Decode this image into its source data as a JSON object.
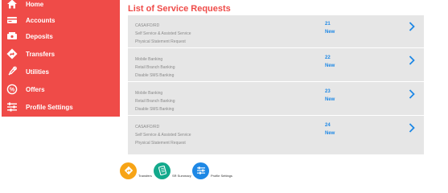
{
  "sidebar": {
    "items": [
      {
        "label": "Home",
        "icon": "home-icon"
      },
      {
        "label": "Accounts",
        "icon": "accounts-icon"
      },
      {
        "label": "Deposits",
        "icon": "deposits-icon"
      },
      {
        "label": "Transfers",
        "icon": "transfers-icon"
      },
      {
        "label": "Utilities",
        "icon": "utilities-icon"
      },
      {
        "label": "Offers",
        "icon": "offers-icon"
      },
      {
        "label": "Profile Settings",
        "icon": "profile-settings-icon"
      }
    ]
  },
  "main": {
    "title": "List of Service Requests",
    "requests": [
      {
        "lines": [
          "CASA/FD/RD",
          "Self Service & Assisted Service",
          "Physical Statement Request"
        ],
        "id": "21",
        "status": "New"
      },
      {
        "lines": [
          "Mobile Banking",
          "Retail Branch Banking",
          "Disable SMS Banking"
        ],
        "id": "22",
        "status": "New"
      },
      {
        "lines": [
          "Mobile Banking",
          "Retail Branch Banking",
          "Disable SMS Banking"
        ],
        "id": "23",
        "status": "New"
      },
      {
        "lines": [
          "CASA/FD/RD",
          "Self Service & Assisted Service",
          "Physical Statement Request"
        ],
        "id": "24",
        "status": "New"
      }
    ]
  },
  "quick_actions": [
    {
      "label": "Transfers",
      "icon": "transfers-icon",
      "color": "#f7a416"
    },
    {
      "label": "SR Summary",
      "icon": "sr-summary-icon",
      "color": "#13a98c"
    },
    {
      "label": "Profile Settings",
      "icon": "profile-settings-icon",
      "color": "#1e88e5"
    }
  ],
  "colors": {
    "brand": "#ef4b48",
    "accent": "#1e88e5",
    "panel": "#e6e6e6"
  }
}
